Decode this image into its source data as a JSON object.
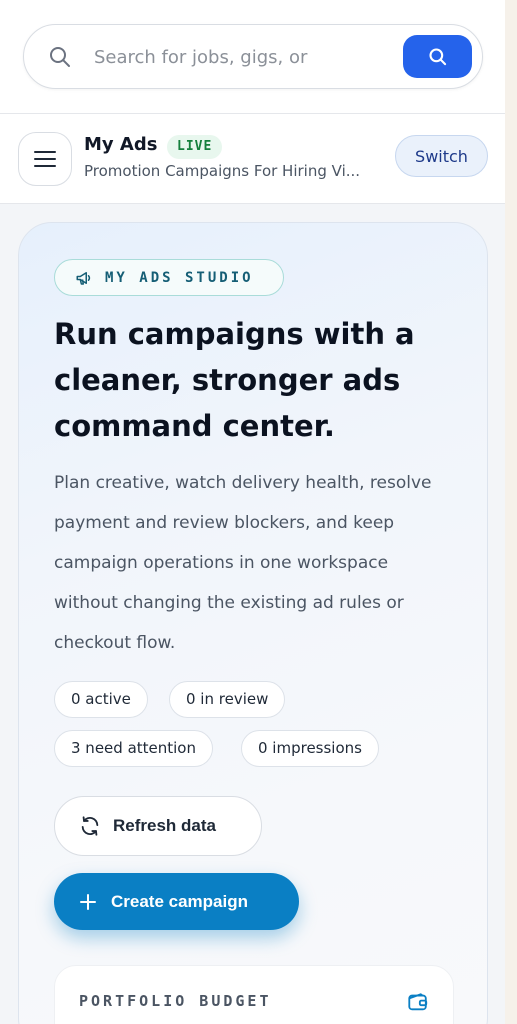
{
  "search": {
    "placeholder": "Search for jobs, gigs, or",
    "value": ""
  },
  "subheader": {
    "title": "My Ads",
    "badge": "LIVE",
    "subtitle": "Promotion Campaigns For Hiring Vi...",
    "switch_label": "Switch"
  },
  "hero": {
    "eyebrow": "MY ADS STUDIO",
    "title": "Run campaigns with a cleaner, stronger ads command center.",
    "description": "Plan creative, watch delivery health, resolve payment and review blockers, and keep campaign operations in one workspace without changing the existing ad rules or checkout flow.",
    "stats": [
      "0 active",
      "0 in review",
      "3 need attention",
      "0 impressions"
    ],
    "refresh_label": "Refresh data",
    "create_label": "Create campaign"
  },
  "budget": {
    "label": "PORTFOLIO BUDGET"
  },
  "colors": {
    "primary_blue": "#2563eb",
    "create_button": "#0a7fc4",
    "live_badge": "#15803d",
    "eyebrow_text": "#155e75"
  },
  "icons": [
    "search-icon",
    "menu-icon",
    "megaphone-icon",
    "refresh-icon",
    "plus-icon",
    "wallet-icon"
  ]
}
